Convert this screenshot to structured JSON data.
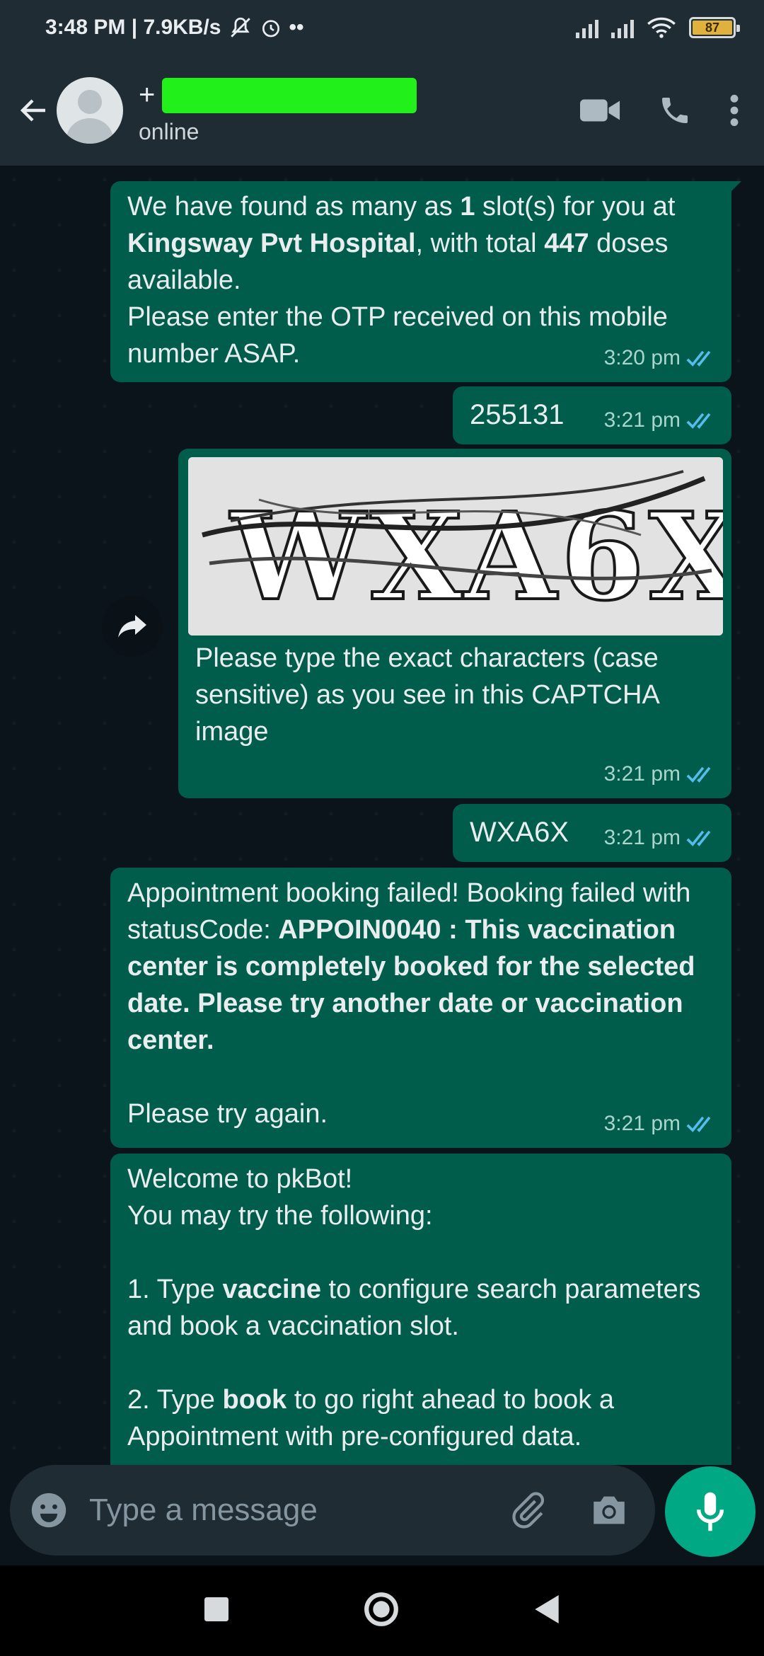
{
  "status_bar": {
    "time_speed": "3:48 PM | 7.9KB/s",
    "extra": "••",
    "battery": "87"
  },
  "header": {
    "name_prefix": "+",
    "status": "online"
  },
  "messages": [
    {
      "type": "out",
      "parts": [
        {
          "t": "We have found as many as "
        },
        {
          "t": "1",
          "b": true
        },
        {
          "t": " slot(s) for you at "
        },
        {
          "t": "Kingsway Pvt Hospital",
          "b": true
        },
        {
          "t": ", with total "
        },
        {
          "t": "447",
          "b": true
        },
        {
          "t": " doses available."
        },
        {
          "br": true
        },
        {
          "t": "Please enter the OTP received on this mobile number ASAP."
        }
      ],
      "time": "3:20 pm"
    },
    {
      "type": "out",
      "text": "255131",
      "time": "3:21 pm"
    },
    {
      "type": "out-image",
      "captcha": "WXA6X",
      "text": "Please type the exact characters (case sensitive) as you see in this CAPTCHA image",
      "time": "3:21 pm"
    },
    {
      "type": "out",
      "text": "WXA6X",
      "time": "3:21 pm"
    },
    {
      "type": "out",
      "parts": [
        {
          "t": "Appointment booking failed! Booking failed with statusCode: "
        },
        {
          "t": "APPOIN0040 : This vaccination center is completely booked for the selected date. Please try another date or vaccination center.",
          "b": true
        },
        {
          "br": true
        },
        {
          "br": true
        },
        {
          "t": "Please try again."
        }
      ],
      "time": "3:21 pm"
    },
    {
      "type": "out",
      "parts": [
        {
          "t": "Welcome to pkBot!"
        },
        {
          "br": true
        },
        {
          "t": "You may try the following:"
        },
        {
          "br": true
        },
        {
          "br": true
        },
        {
          "t": "1. Type "
        },
        {
          "t": "vaccine",
          "b": true
        },
        {
          "t": " to configure search parameters and book a vaccination slot."
        },
        {
          "br": true
        },
        {
          "br": true
        },
        {
          "t": "2. Type "
        },
        {
          "t": "book",
          "b": true
        },
        {
          "t": " to go right ahead to book a Appointment with pre-configured data."
        }
      ]
    }
  ],
  "input": {
    "placeholder": "Type a message"
  },
  "colors": {
    "bubble_out": "#005c4b",
    "header_bg": "#1f2c34",
    "chat_bg": "#0b141a",
    "accent": "#00a884",
    "read_ticks": "#53bdeb"
  }
}
